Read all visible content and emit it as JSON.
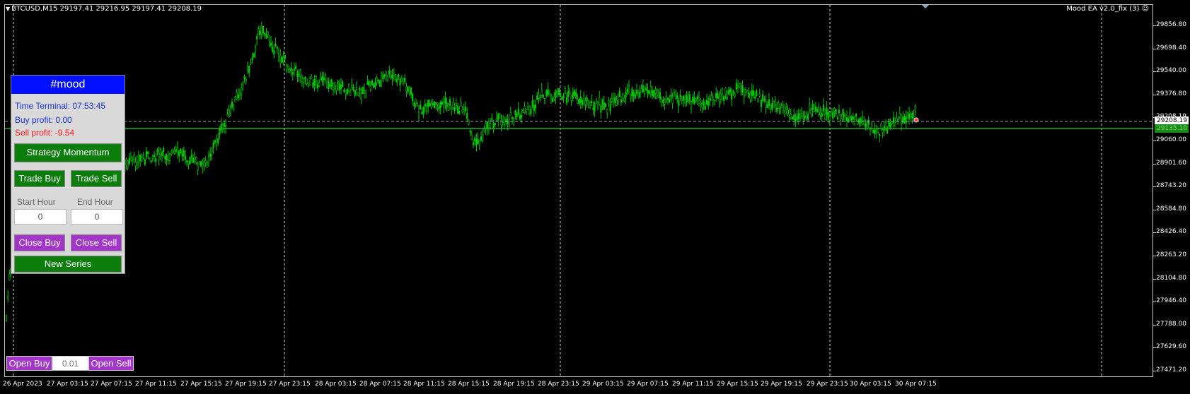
{
  "window": {
    "symbol_info": "BTCUSD,M15  29197.41 29216.95 29197.41 29208.19",
    "ea_name": "Mood EA  v2.0_fix (3)",
    "ea_smiley": "☺"
  },
  "price_axis": {
    "ticks": [
      "29856.80",
      "29698.40",
      "29540.00",
      "29376.80",
      "29208.19",
      "29060.00",
      "28901.60",
      "28743.20",
      "28584.80",
      "28426.40",
      "28263.20",
      "28104.80",
      "27946.40",
      "27788.00",
      "27629.60",
      "27471.20"
    ],
    "bid_tag": "29208.19",
    "buy_tag": "29135.10"
  },
  "time_axis": {
    "ticks": [
      "26 Apr 2023",
      "27 Apr 03:15",
      "27 Apr 07:15",
      "27 Apr 11:15",
      "27 Apr 15:15",
      "27 Apr 19:15",
      "27 Apr 23:15",
      "28 Apr 03:15",
      "28 Apr 07:15",
      "28 Apr 11:15",
      "28 Apr 15:15",
      "28 Apr 19:15",
      "28 Apr 23:15",
      "29 Apr 03:15",
      "29 Apr 07:15",
      "29 Apr 11:15",
      "29 Apr 15:15",
      "29 Apr 19:15",
      "29 Apr 23:15",
      "30 Apr 03:15",
      "30 Apr 07:15"
    ]
  },
  "panel": {
    "title": "#mood",
    "time_terminal": "Time Terminal: 07:53:45",
    "buy_profit": "Buy profit: 0.00",
    "sell_profit": "Sell profit: -9.54",
    "strategy_button": "Strategy Momentum",
    "trade_buy": "Trade Buy",
    "trade_sell": "Trade Sell",
    "start_hour_label": "Start Hour",
    "end_hour_label": "End Hour",
    "start_hour_value": "0",
    "end_hour_value": "0",
    "close_buy": "Close Buy",
    "close_sell": "Close Sell",
    "new_series": "New Series"
  },
  "quick_trade": {
    "open_buy": "Open Buy",
    "lot": "0.01",
    "open_sell": "Open Sell"
  },
  "colors": {
    "candle": "#00c800",
    "panel_header": "#0010ff",
    "green_button": "#0a7d0a",
    "purple_button": "#a335c9"
  }
}
